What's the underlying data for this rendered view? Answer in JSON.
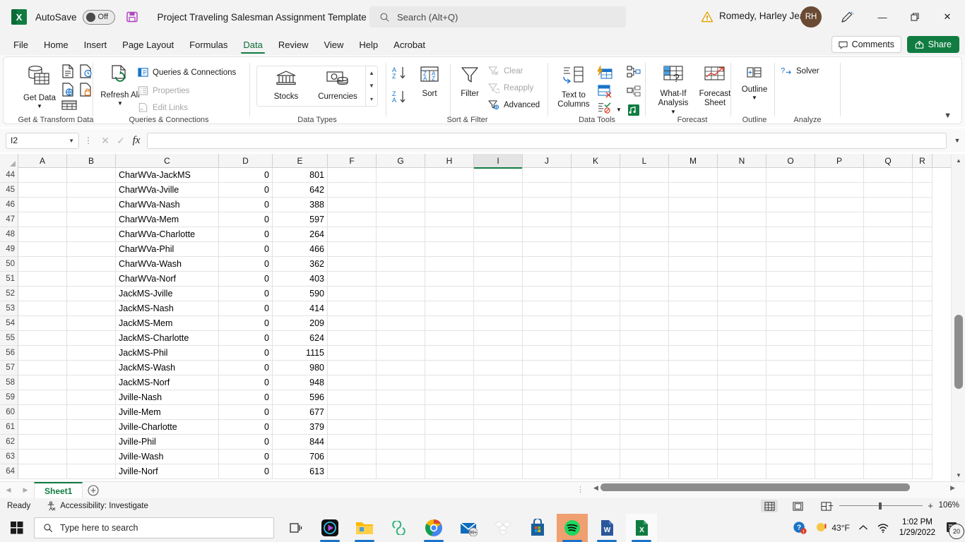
{
  "titlebar": {
    "app_logo": "excel-logo",
    "logo_letter": "X",
    "autosave_label": "AutoSave",
    "autosave_state": "Off",
    "document_title": "Project Traveling Salesman Assignment Template",
    "search_placeholder": "Search (Alt+Q)",
    "user_name": "Romedy, Harley Jean",
    "user_initials": "RH",
    "minimize": "—",
    "restore": "❐",
    "close": "✕"
  },
  "tabs": [
    {
      "label": "File",
      "active": false
    },
    {
      "label": "Home",
      "active": false
    },
    {
      "label": "Insert",
      "active": false
    },
    {
      "label": "Page Layout",
      "active": false
    },
    {
      "label": "Formulas",
      "active": false
    },
    {
      "label": "Data",
      "active": true
    },
    {
      "label": "Review",
      "active": false
    },
    {
      "label": "View",
      "active": false
    },
    {
      "label": "Help",
      "active": false
    },
    {
      "label": "Acrobat",
      "active": false
    }
  ],
  "tabbar_right": {
    "comments_label": "Comments",
    "share_label": "Share"
  },
  "ribbon": {
    "groups": [
      {
        "name": "Get & Transform Data",
        "items": [
          {
            "label": "Get Data",
            "type": "big",
            "has_dropdown": true
          },
          {
            "label": "From Text/CSV",
            "type": "icon"
          },
          {
            "label": "From Web",
            "type": "icon"
          },
          {
            "label": "From Table/Range",
            "type": "icon"
          },
          {
            "label": "Recent Sources",
            "type": "icon"
          },
          {
            "label": "Existing Connections",
            "type": "icon"
          }
        ]
      },
      {
        "name": "Queries & Connections",
        "items": [
          {
            "label": "Refresh All",
            "type": "big",
            "has_dropdown": true
          },
          {
            "label": "Queries & Connections",
            "type": "small",
            "disabled": false
          },
          {
            "label": "Properties",
            "type": "small",
            "disabled": true
          },
          {
            "label": "Edit Links",
            "type": "small",
            "disabled": true
          }
        ]
      },
      {
        "name": "Data Types",
        "items": [
          {
            "label": "Stocks",
            "type": "big"
          },
          {
            "label": "Currencies",
            "type": "big"
          }
        ]
      },
      {
        "name": "Sort & Filter",
        "items": [
          {
            "label": "Sort A to Z",
            "type": "icon"
          },
          {
            "label": "Sort Z to A",
            "type": "icon"
          },
          {
            "label": "Sort",
            "type": "big"
          },
          {
            "label": "Filter",
            "type": "big"
          },
          {
            "label": "Clear",
            "type": "small",
            "disabled": true
          },
          {
            "label": "Reapply",
            "type": "small",
            "disabled": true
          },
          {
            "label": "Advanced",
            "type": "small",
            "disabled": false
          }
        ]
      },
      {
        "name": "Data Tools",
        "items": [
          {
            "label": "Text to Columns",
            "type": "big"
          },
          {
            "label": "Flash Fill",
            "type": "icon"
          },
          {
            "label": "Remove Duplicates",
            "type": "icon"
          },
          {
            "label": "Data Validation",
            "type": "icon"
          },
          {
            "label": "Consolidate",
            "type": "icon"
          },
          {
            "label": "Relationships",
            "type": "icon"
          },
          {
            "label": "Manage Data Model",
            "type": "icon"
          }
        ]
      },
      {
        "name": "Forecast",
        "items": [
          {
            "label": "What-If Analysis",
            "type": "big",
            "has_dropdown": true
          },
          {
            "label": "Forecast Sheet",
            "type": "big"
          }
        ]
      },
      {
        "name": "Outline",
        "items": [
          {
            "label": "Outline",
            "type": "big",
            "has_dropdown": true
          }
        ]
      },
      {
        "name": "Analyze",
        "items": [
          {
            "label": "Solver",
            "type": "small"
          }
        ]
      }
    ]
  },
  "formula_bar": {
    "name_box_value": "I2",
    "cancel_icon": "✕",
    "enter_icon": "✓",
    "fx_label": "fx",
    "formula_value": ""
  },
  "grid": {
    "columns": [
      "A",
      "B",
      "C",
      "D",
      "E",
      "F",
      "G",
      "H",
      "I",
      "J",
      "K",
      "L",
      "M",
      "N",
      "O",
      "P",
      "Q",
      "R"
    ],
    "selected_column": "I",
    "rows": [
      {
        "num": "44",
        "C": "CharWVa-JackMS",
        "D": "0",
        "E": "801"
      },
      {
        "num": "45",
        "C": "CharWVa-Jville",
        "D": "0",
        "E": "642"
      },
      {
        "num": "46",
        "C": "CharWVa-Nash",
        "D": "0",
        "E": "388"
      },
      {
        "num": "47",
        "C": "CharWVa-Mem",
        "D": "0",
        "E": "597"
      },
      {
        "num": "48",
        "C": "CharWVa-Charlotte",
        "D": "0",
        "E": "264"
      },
      {
        "num": "49",
        "C": "CharWVa-Phil",
        "D": "0",
        "E": "466"
      },
      {
        "num": "50",
        "C": "CharWVa-Wash",
        "D": "0",
        "E": "362"
      },
      {
        "num": "51",
        "C": "CharWVa-Norf",
        "D": "0",
        "E": "403"
      },
      {
        "num": "52",
        "C": "JackMS-Jville",
        "D": "0",
        "E": "590"
      },
      {
        "num": "53",
        "C": "JackMS-Nash",
        "D": "0",
        "E": "414"
      },
      {
        "num": "54",
        "C": "JackMS-Mem",
        "D": "0",
        "E": "209"
      },
      {
        "num": "55",
        "C": "JackMS-Charlotte",
        "D": "0",
        "E": "624"
      },
      {
        "num": "56",
        "C": "JackMS-Phil",
        "D": "0",
        "E": "1115"
      },
      {
        "num": "57",
        "C": "JackMS-Wash",
        "D": "0",
        "E": "980"
      },
      {
        "num": "58",
        "C": "JackMS-Norf",
        "D": "0",
        "E": "948"
      },
      {
        "num": "59",
        "C": "Jville-Nash",
        "D": "0",
        "E": "596"
      },
      {
        "num": "60",
        "C": "Jville-Mem",
        "D": "0",
        "E": "677"
      },
      {
        "num": "61",
        "C": "Jville-Charlotte",
        "D": "0",
        "E": "379"
      },
      {
        "num": "62",
        "C": "Jville-Phil",
        "D": "0",
        "E": "844"
      },
      {
        "num": "63",
        "C": "Jville-Wash",
        "D": "0",
        "E": "706"
      },
      {
        "num": "64",
        "C": "Jville-Norf",
        "D": "0",
        "E": "613"
      }
    ]
  },
  "sheetbar": {
    "prev_arrow": "◀",
    "next_arrow": "▶",
    "sheets": [
      {
        "label": "Sheet1",
        "active": true
      }
    ],
    "add_sheet": "+"
  },
  "statusbar": {
    "mode": "Ready",
    "accessibility": "Accessibility: Investigate",
    "view_normal": "normal-view",
    "view_page_layout": "page-layout-view",
    "view_page_break": "page-break-view",
    "zoom_out": "−",
    "zoom_in": "+",
    "zoom_level": "106%"
  },
  "taskbar": {
    "search_placeholder": "Type here to search",
    "apps": [
      {
        "name": "task-view"
      },
      {
        "name": "movies-tv"
      },
      {
        "name": "file-explorer"
      },
      {
        "name": "office"
      },
      {
        "name": "chrome"
      },
      {
        "name": "mail",
        "badge": "99+"
      },
      {
        "name": "dropbox"
      },
      {
        "name": "microsoft-store"
      },
      {
        "name": "spotify"
      },
      {
        "name": "word"
      },
      {
        "name": "excel"
      }
    ],
    "tray": {
      "temperature": "43°F",
      "time": "1:02 PM",
      "date": "1/29/2022",
      "notification_count": "20"
    }
  },
  "colors": {
    "excel_green": "#107c41",
    "accent_blue": "#1a73c8",
    "avatar_brown": "#6b4a33"
  }
}
